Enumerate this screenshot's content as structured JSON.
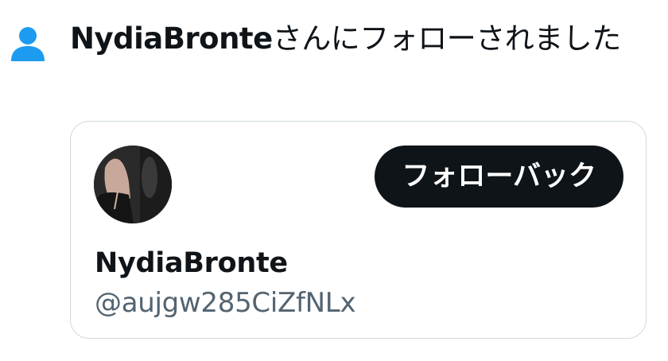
{
  "notification": {
    "icon": "person-icon",
    "icon_color": "#1d9bf0",
    "actor_name": "NydiaBronte",
    "message": "さんにフォローされました"
  },
  "user_card": {
    "avatar": "user-avatar",
    "follow_back_label": "フォローバック",
    "display_name": "NydiaBronte",
    "handle": "@aujgw285CiZfNLx"
  },
  "colors": {
    "text_primary": "#0f1419",
    "text_secondary": "#536471",
    "accent": "#1d9bf0",
    "button_bg": "#0f1419",
    "card_border": "#cfd9de"
  }
}
